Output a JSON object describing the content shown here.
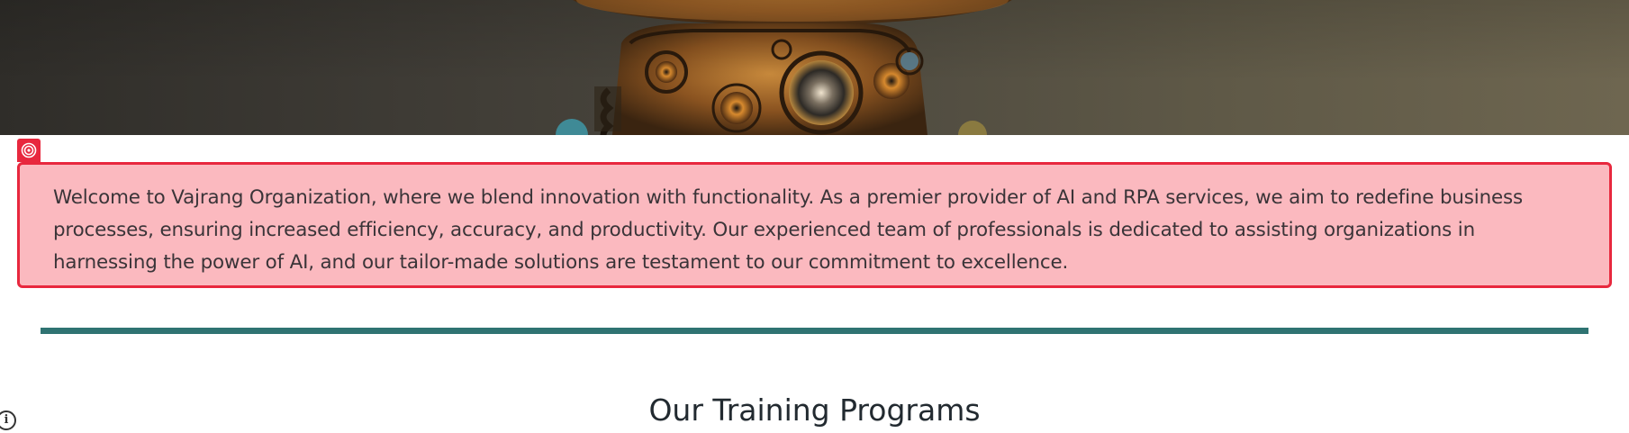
{
  "intro": {
    "text": "Welcome to Vajrang Organization, where we blend innovation with functionality. As a premier provider of AI and RPA services, we aim to redefine business processes, ensuring increased efficiency, accuracy, and productivity. Our experienced team of professionals is dedicated to assisting organizations in harnessing the power of AI, and our tailor-made solutions are testament to our commitment to excellence."
  },
  "section": {
    "title": "Our Training Programs"
  },
  "colors": {
    "highlight_border": "#e8283e",
    "highlight_fill": "#fbb9bf",
    "divider": "#2f7372",
    "heading": "#222a30"
  },
  "icons": {
    "block_tag": "target-icon",
    "info": "info-icon"
  }
}
